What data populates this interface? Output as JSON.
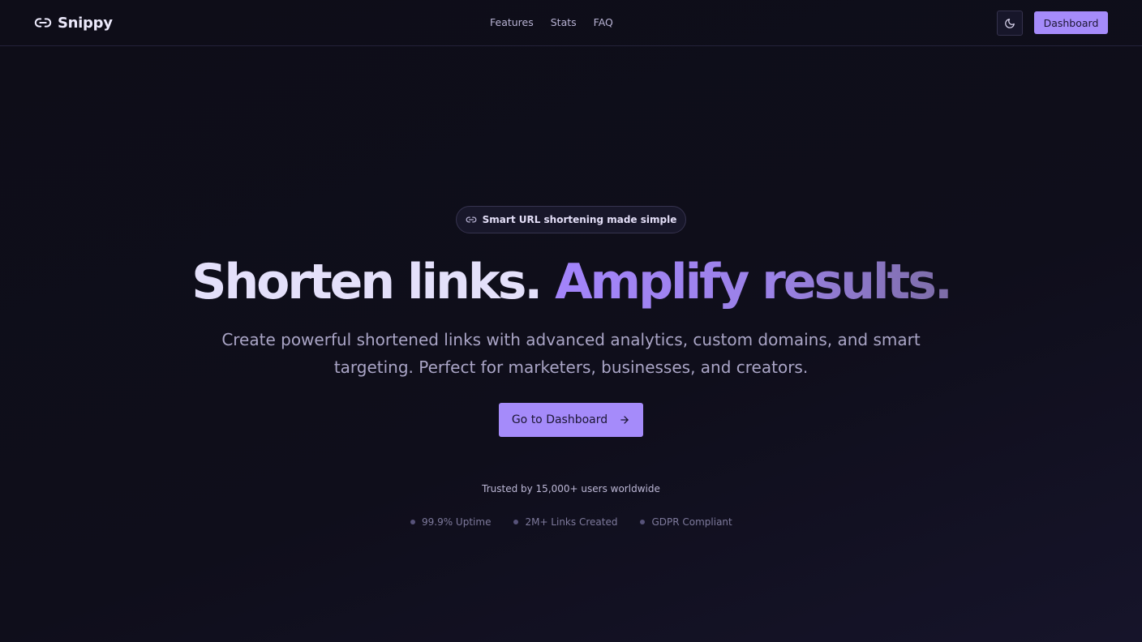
{
  "navbar": {
    "brand": "Snippy",
    "links": [
      "Features",
      "Stats",
      "FAQ"
    ],
    "dashboard_label": "Dashboard"
  },
  "hero": {
    "badge": "Smart URL shortening made simple",
    "headline_part1": "Shorten links.",
    "headline_part2": "Amplify results.",
    "subtitle": "Create powerful shortened links with advanced analytics, custom domains, and smart targeting. Perfect for marketers, businesses, and creators.",
    "cta_label": "Go to Dashboard",
    "trusted": "Trusted by 15,000+ users worldwide",
    "stats": [
      "99.9% Uptime",
      "2M+ Links Created",
      "GDPR Compliant"
    ]
  },
  "colors": {
    "accent": "#a58bfa",
    "background": "#0f0e1a"
  },
  "icons": {
    "brand": "link-icon",
    "theme": "moon-icon",
    "badge": "link-icon",
    "cta": "arrow-right-icon"
  }
}
